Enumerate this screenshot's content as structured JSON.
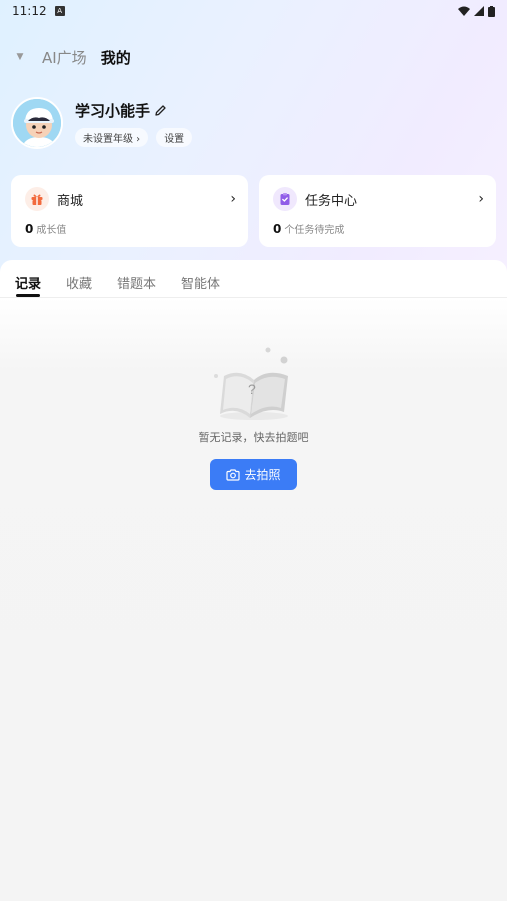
{
  "status_bar": {
    "time": "11:12",
    "badge": "A"
  },
  "top_nav": {
    "tabs": [
      {
        "label": "AI广场"
      },
      {
        "label": "我的"
      }
    ]
  },
  "profile": {
    "name": "学习小能手",
    "chips": {
      "grade": "未设置年级 ›",
      "settings": "设置"
    }
  },
  "cards": {
    "mall": {
      "title": "商城",
      "count": "0",
      "desc": "成长值"
    },
    "tasks": {
      "title": "任务中心",
      "count": "0",
      "desc": "个任务待完成"
    }
  },
  "content_tabs": [
    {
      "label": "记录"
    },
    {
      "label": "收藏"
    },
    {
      "label": "错题本"
    },
    {
      "label": "智能体"
    }
  ],
  "empty_state": {
    "message": "暂无记录，快去拍题吧",
    "button_label": "去拍照"
  },
  "colors": {
    "accent": "#3b7cf6",
    "mall_icon": "#f26a3d",
    "task_icon": "#8f5be8"
  }
}
